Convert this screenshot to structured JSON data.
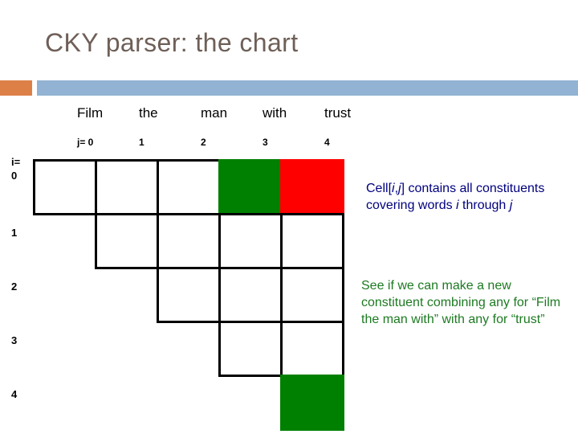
{
  "slide": {
    "title": "CKY parser: the chart",
    "title_color": "#6e5f57",
    "accent_orange": "#dd8048",
    "accent_blue": "#92b3d3"
  },
  "chart_data": {
    "type": "table",
    "title": "CKY parser: the chart",
    "description": "Upper-triangular CKY chart over a 5-word sentence",
    "row_axis_label": "i=",
    "col_axis_label": "j=",
    "words": [
      "Film",
      "the",
      "man",
      "with",
      "trust"
    ],
    "col_indices": [
      "j= 0",
      "1",
      "2",
      "3",
      "4"
    ],
    "row_indices": [
      "0",
      "1",
      "2",
      "3",
      "4"
    ],
    "n": 5,
    "highlight_colors": {
      "green": "#008000",
      "red": "#ff0000",
      "empty": "#ffffff",
      "border": "#000000"
    },
    "cells": [
      {
        "i": 0,
        "j": 0,
        "fill": "empty"
      },
      {
        "i": 0,
        "j": 1,
        "fill": "empty"
      },
      {
        "i": 0,
        "j": 2,
        "fill": "empty"
      },
      {
        "i": 0,
        "j": 3,
        "fill": "green"
      },
      {
        "i": 0,
        "j": 4,
        "fill": "red"
      },
      {
        "i": 1,
        "j": 1,
        "fill": "empty"
      },
      {
        "i": 1,
        "j": 2,
        "fill": "empty"
      },
      {
        "i": 1,
        "j": 3,
        "fill": "empty"
      },
      {
        "i": 1,
        "j": 4,
        "fill": "empty"
      },
      {
        "i": 2,
        "j": 2,
        "fill": "empty"
      },
      {
        "i": 2,
        "j": 3,
        "fill": "empty"
      },
      {
        "i": 2,
        "j": 4,
        "fill": "empty"
      },
      {
        "i": 3,
        "j": 3,
        "fill": "empty"
      },
      {
        "i": 3,
        "j": 4,
        "fill": "empty"
      },
      {
        "i": 4,
        "j": 4,
        "fill": "green"
      }
    ]
  },
  "notes": {
    "cell_definition": {
      "color": "#00007f",
      "parts": [
        {
          "text": "Cell[",
          "style": "normal"
        },
        {
          "text": "i",
          "style": "italic"
        },
        {
          "text": ",",
          "style": "normal"
        },
        {
          "text": "j",
          "style": "italic"
        },
        {
          "text": "] contains all constituents covering words ",
          "style": "normal"
        },
        {
          "text": "i",
          "style": "italic"
        },
        {
          "text": " through ",
          "style": "normal"
        },
        {
          "text": "j",
          "style": "italic"
        }
      ],
      "plain": "Cell[i,j] contains all constituents covering words i through j"
    },
    "combine_step": {
      "color": "#1d7a22",
      "plain": "See if we can make a new constituent combining any for “Film the man with” with any for “trust”"
    }
  }
}
